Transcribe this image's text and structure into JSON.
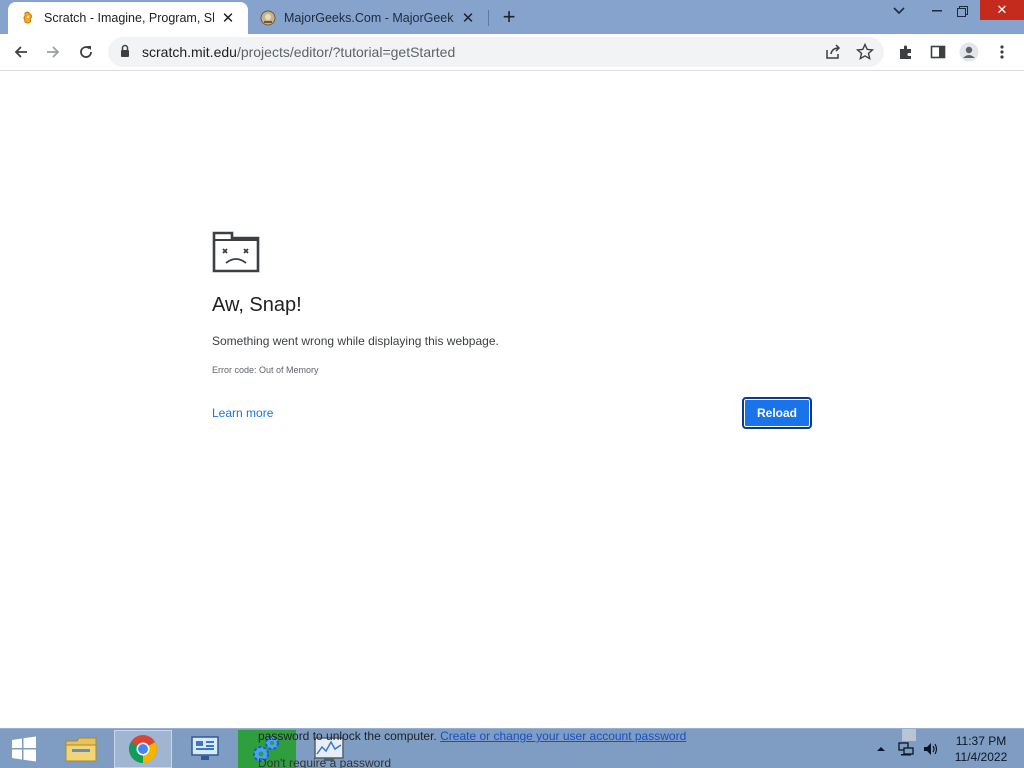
{
  "tabs": [
    {
      "title": "Scratch - Imagine, Program, Share",
      "favicon": "scratch-cat-icon",
      "active": true
    },
    {
      "title": "MajorGeeks.Com - MajorGeeks",
      "favicon": "majorgeeks-icon",
      "active": false
    }
  ],
  "omnibox": {
    "host": "scratch.mit.edu",
    "path": "/projects/editor/?tutorial=getStarted"
  },
  "error": {
    "title": "Aw, Snap!",
    "description": "Something went wrong while displaying this webpage.",
    "code": "Error code: Out of Memory",
    "learn_more": "Learn more",
    "reload": "Reload"
  },
  "taskbar": {
    "bleed_text": "password to unlock the computer.",
    "bleed_link": "Create or change your user account password",
    "bleed_text2": "Don't require a password",
    "time": "11:37 PM",
    "date": "11/4/2022"
  },
  "colors": {
    "tabstrip": "#85a3cd",
    "accent": "#1a73e8",
    "taskbar": "#7f9dc2"
  }
}
